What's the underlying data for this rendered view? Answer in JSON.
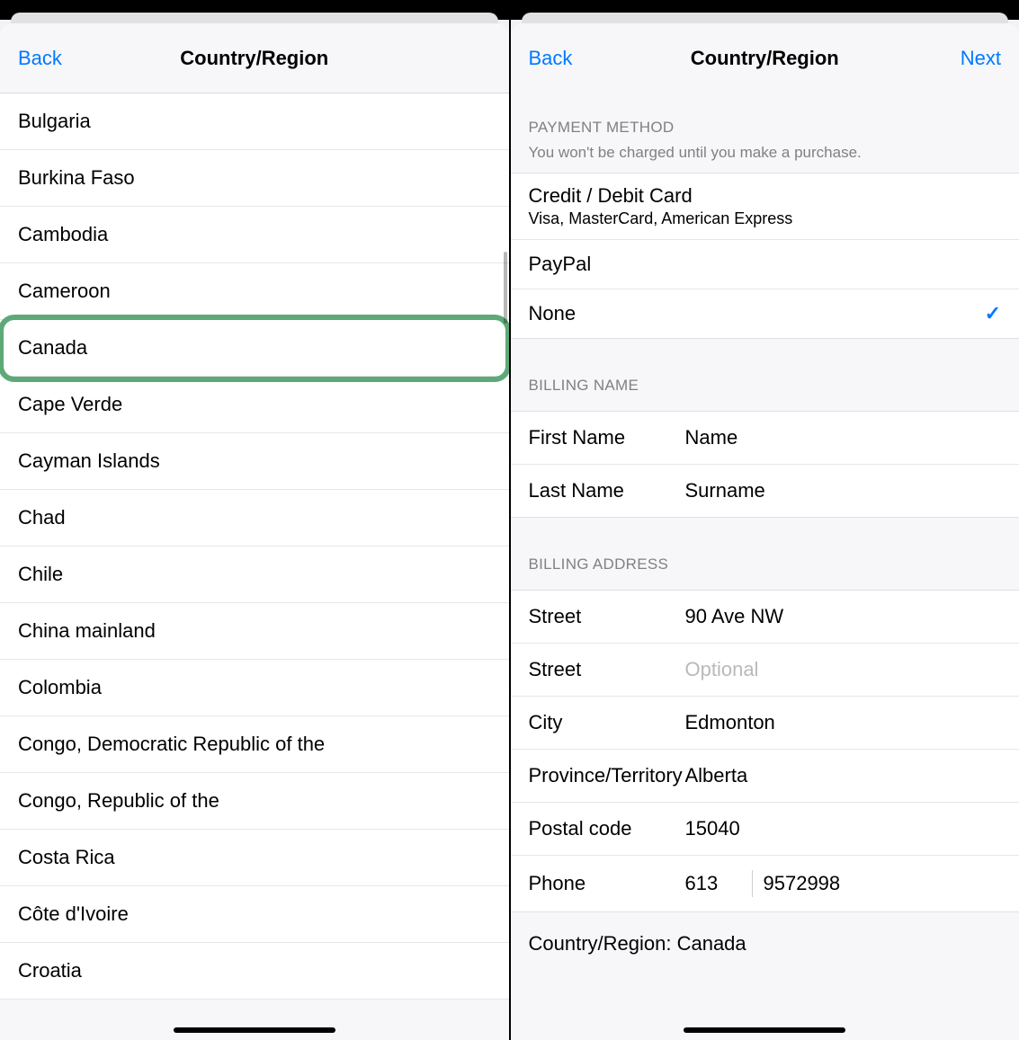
{
  "left": {
    "nav": {
      "back": "Back",
      "title": "Country/Region"
    },
    "countries": [
      "Bulgaria",
      "Burkina Faso",
      "Cambodia",
      "Cameroon",
      "Canada",
      "Cape Verde",
      "Cayman Islands",
      "Chad",
      "Chile",
      "China mainland",
      "Colombia",
      "Congo, Democratic Republic of the",
      "Congo, Republic of the",
      "Costa Rica",
      "Côte d'Ivoire",
      "Croatia"
    ],
    "highlighted_index": 4
  },
  "right": {
    "nav": {
      "back": "Back",
      "title": "Country/Region",
      "next": "Next"
    },
    "payment": {
      "header": "Payment Method",
      "note": "You won't be charged until you make a purchase.",
      "options": [
        {
          "label": "Credit / Debit Card",
          "sub": "Visa, MasterCard, American Express",
          "selected": false
        },
        {
          "label": "PayPal",
          "selected": false
        },
        {
          "label": "None",
          "selected": true
        }
      ]
    },
    "billing_name": {
      "header": "Billing Name",
      "first_label": "First Name",
      "first_value": "Name",
      "last_label": "Last Name",
      "last_value": "Surname"
    },
    "billing_address": {
      "header": "Billing Address",
      "street1_label": "Street",
      "street1_value": "90 Ave NW",
      "street2_label": "Street",
      "street2_placeholder": "Optional",
      "city_label": "City",
      "city_value": "Edmonton",
      "province_label": "Province/Territory",
      "province_value": "Alberta",
      "postal_label": "Postal code",
      "postal_value": "15040",
      "phone_label": "Phone",
      "phone_code": "613",
      "phone_number": "9572998"
    },
    "region_footer": "Country/Region: Canada"
  },
  "icons": {
    "check": "✓"
  }
}
